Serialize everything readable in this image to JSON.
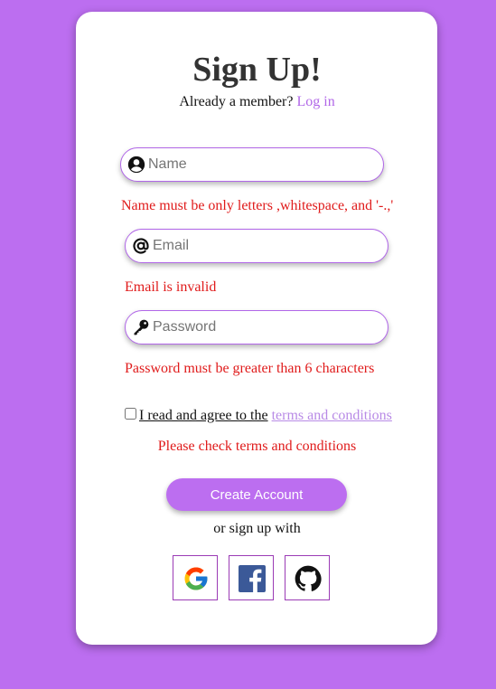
{
  "header": {
    "title": "Sign Up!",
    "member_prompt": "Already a member?",
    "login_link": "Log in"
  },
  "form": {
    "name": {
      "placeholder": "Name",
      "value": "",
      "error": "Name must be only letters ,whitespace, and '-.,'"
    },
    "email": {
      "placeholder": "Email",
      "value": "",
      "error": "Email is invalid"
    },
    "password": {
      "placeholder": "Password",
      "value": "",
      "error": "Password must be greater than 6 characters"
    },
    "terms": {
      "checked": false,
      "label": "I read and agree to the",
      "link": "terms and conditions",
      "error": "Please check terms and conditions"
    },
    "submit_label": "Create Account"
  },
  "social": {
    "prompt": "or sign up with",
    "providers": [
      {
        "name": "Google",
        "icon": "google-icon"
      },
      {
        "name": "Facebook",
        "icon": "facebook-icon"
      },
      {
        "name": "GitHub",
        "icon": "github-icon"
      }
    ]
  },
  "colors": {
    "background": "#bc6ef0",
    "accent": "#b167e8",
    "error": "#e01b1b",
    "card": "#ffffff"
  }
}
